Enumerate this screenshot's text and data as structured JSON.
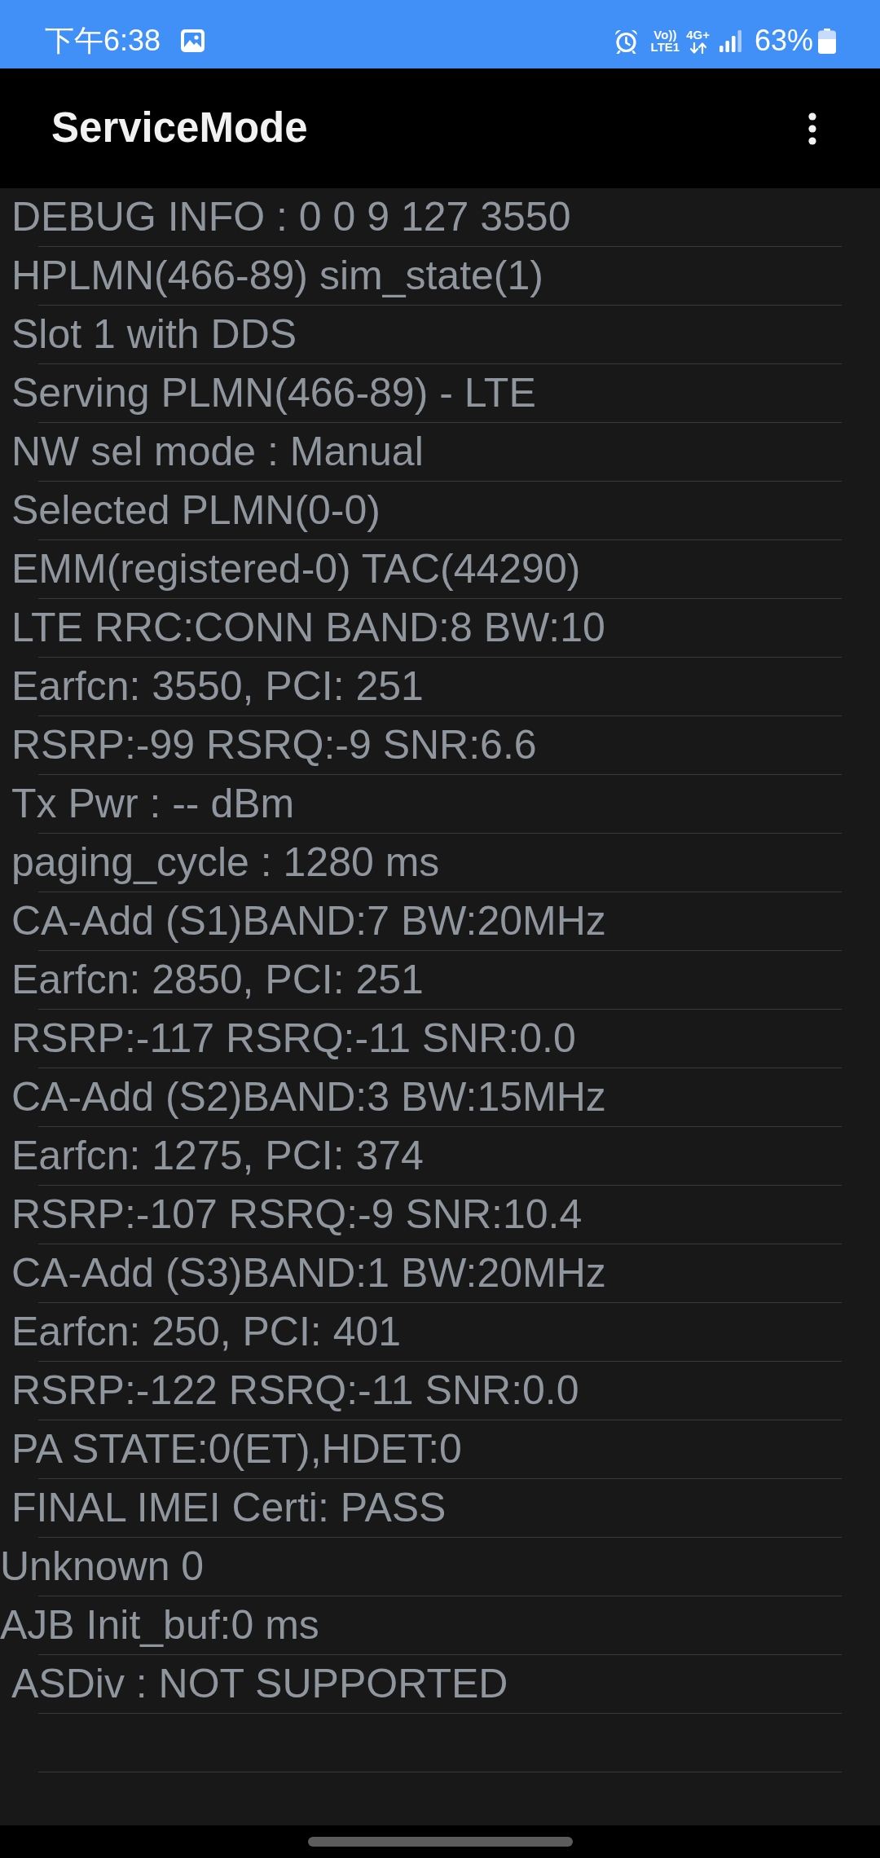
{
  "status_bar": {
    "time": "下午6:38",
    "volte_top": "Vo))",
    "volte_bottom": "LTE1",
    "network": "4G+",
    "battery": "63%"
  },
  "app_bar": {
    "title": "ServiceMode"
  },
  "rows": [
    {
      "text": "DEBUG INFO : 0 0 9 127 3550",
      "indented": true
    },
    {
      "text": "HPLMN(466-89) sim_state(1)",
      "indented": true
    },
    {
      "text": "Slot 1 with DDS",
      "indented": true
    },
    {
      "text": "Serving PLMN(466-89) - LTE",
      "indented": true
    },
    {
      "text": "NW sel mode : Manual",
      "indented": true
    },
    {
      "text": "Selected PLMN(0-0)",
      "indented": true
    },
    {
      "text": "EMM(registered-0) TAC(44290)",
      "indented": true
    },
    {
      "text": "LTE RRC:CONN BAND:8 BW:10",
      "indented": true
    },
    {
      "text": "Earfcn: 3550, PCI: 251",
      "indented": true
    },
    {
      "text": "RSRP:-99 RSRQ:-9 SNR:6.6",
      "indented": true
    },
    {
      "text": "Tx Pwr : -- dBm",
      "indented": true
    },
    {
      "text": "paging_cycle : 1280 ms",
      "indented": true
    },
    {
      "text": "CA-Add (S1)BAND:7 BW:20MHz",
      "indented": true
    },
    {
      "text": "Earfcn: 2850, PCI: 251",
      "indented": true
    },
    {
      "text": "RSRP:-117 RSRQ:-11 SNR:0.0",
      "indented": true
    },
    {
      "text": "CA-Add (S2)BAND:3 BW:15MHz",
      "indented": true
    },
    {
      "text": "Earfcn: 1275, PCI: 374",
      "indented": true
    },
    {
      "text": "RSRP:-107 RSRQ:-9 SNR:10.4",
      "indented": true
    },
    {
      "text": "CA-Add (S3)BAND:1 BW:20MHz",
      "indented": true
    },
    {
      "text": "Earfcn: 250, PCI: 401",
      "indented": true
    },
    {
      "text": "RSRP:-122 RSRQ:-11 SNR:0.0",
      "indented": true
    },
    {
      "text": "PA STATE:0(ET),HDET:0",
      "indented": true
    },
    {
      "text": "FINAL IMEI Certi: PASS",
      "indented": true
    },
    {
      "text": "Unknown 0",
      "indented": false
    },
    {
      "text": "AJB Init_buf:0 ms",
      "indented": false
    },
    {
      "text": "ASDiv : NOT SUPPORTED",
      "indented": true
    }
  ]
}
